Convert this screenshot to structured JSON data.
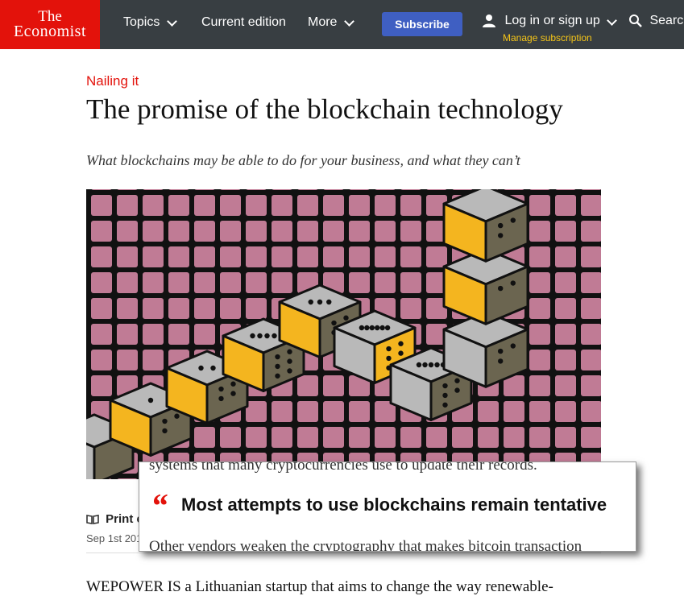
{
  "header": {
    "logo_line1": "The",
    "logo_line2": "Economist",
    "nav_topics": "Topics",
    "nav_current": "Current edition",
    "nav_more": "More",
    "subscribe": "Subscribe",
    "login": "Log in or sign up",
    "manage": "Manage subscription",
    "search": "Search"
  },
  "article": {
    "rubric": "Nailing it",
    "headline": "The promise of the blockchain technology",
    "dek": "What blockchains may be able to do for your business, and what they can’t",
    "print_label": "Print e",
    "date": "Sep 1st 201",
    "body_start": "WEPOWER IS a Lithuanian startup that aims to change the way renewable-"
  },
  "pullquote": {
    "prev_text": "systems that many cryptocurrencies use to update their records.",
    "quote_mark": "“",
    "text": "Most attempts to use blockchains remain tentative",
    "next_text": "Other vendors weaken the cryptography that makes bitcoin transaction"
  },
  "colors": {
    "brand_red": "#e3120b",
    "nav_bg": "#383e42",
    "subscribe_blue": "#3f5fc2",
    "manage_yellow": "#f5c518",
    "grid_pink": "#c07b95",
    "die_yellow": "#f4b51f",
    "die_grey": "#b9b9b9",
    "die_olive": "#6b6550"
  },
  "icons": {
    "user": "person-icon",
    "search": "search-icon",
    "print": "book-icon",
    "chevron": "chevron-down-icon"
  }
}
